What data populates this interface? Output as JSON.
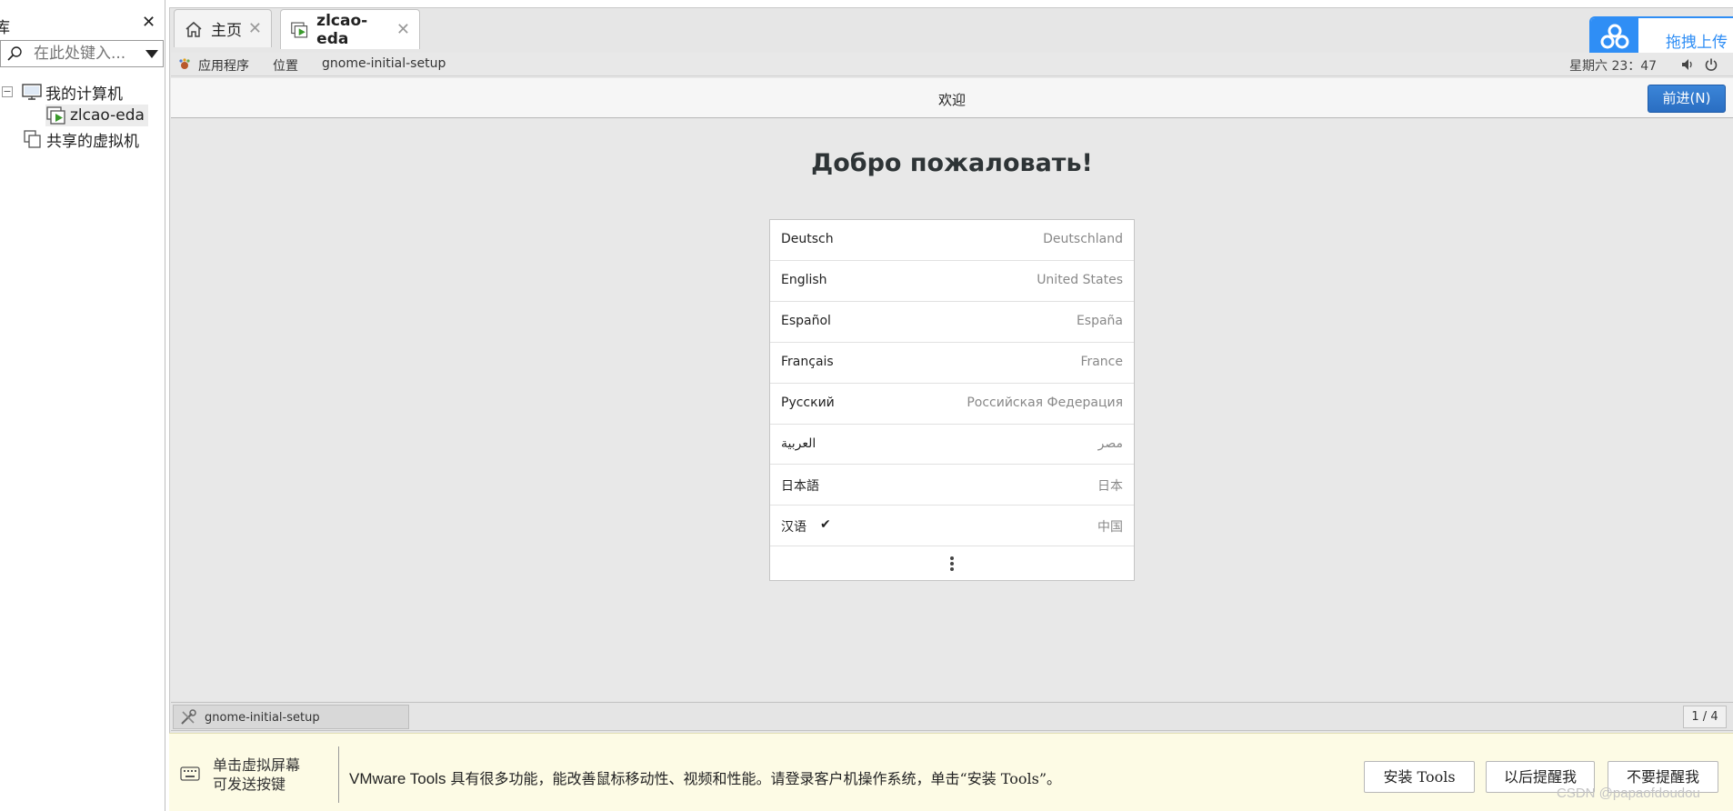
{
  "sidebar": {
    "title": "库",
    "close_glyph": "✕",
    "search_placeholder": "在此处键入...",
    "tree": [
      {
        "label": "我的计算机",
        "toggle": "−",
        "icon": "computer-icon"
      },
      {
        "label": "zlcao-eda",
        "icon": "vm-running-icon"
      },
      {
        "label": "共享的虚拟机",
        "icon": "shared-vms-icon"
      }
    ]
  },
  "tabs": [
    {
      "label": "主页",
      "icon": "home-icon",
      "close": "✕"
    },
    {
      "label": "zlcao-eda",
      "icon": "vm-running-icon",
      "close": "✕"
    }
  ],
  "upload_widget": {
    "label": "拖拽上传",
    "icon": "baidu-cloud-icon"
  },
  "gnome_bar": {
    "applications": "应用程序",
    "places": "位置",
    "app_name": "gnome-initial-setup",
    "clock": "星期六 23：47"
  },
  "setup": {
    "header_title": "欢迎",
    "next_button": "前进(N)",
    "heading": "Добро пожаловать!",
    "languages": [
      {
        "name": "Deutsch",
        "country": "Deutschland",
        "selected": false
      },
      {
        "name": "English",
        "country": "United States",
        "selected": false
      },
      {
        "name": "Español",
        "country": "España",
        "selected": false
      },
      {
        "name": "Français",
        "country": "France",
        "selected": false
      },
      {
        "name": "Русский",
        "country": "Российская Федерация",
        "selected": false
      },
      {
        "name": "العربية",
        "country": "مصر",
        "selected": false
      },
      {
        "name": "日本語",
        "country": "日本",
        "selected": false
      },
      {
        "name": "汉语",
        "country": "中国",
        "selected": true,
        "check": "✔"
      }
    ],
    "more_icon": "more-vertical-icon"
  },
  "taskbar": {
    "task_label": "gnome-initial-setup",
    "pager": "1 / 4"
  },
  "notice": {
    "hint_line1": "单击虚拟屏幕",
    "hint_line2": "可发送按键",
    "message_prefix": "VMware Tools",
    "message_body": " 具有很多功能，能改善鼠标移动性、视频和性能。请登录客户机操作系统，单击“安装 Tools”。",
    "install_button": "安装 Tools",
    "remind_later_button": "以后提醒我",
    "never_remind_button": "不要提醒我"
  },
  "watermark": "CSDN @papaofdoudou",
  "colors": {
    "accent_blue": "#2a6ec2",
    "notice_bg": "#fdfbe5",
    "upload_blue": "#2f8ef5"
  }
}
